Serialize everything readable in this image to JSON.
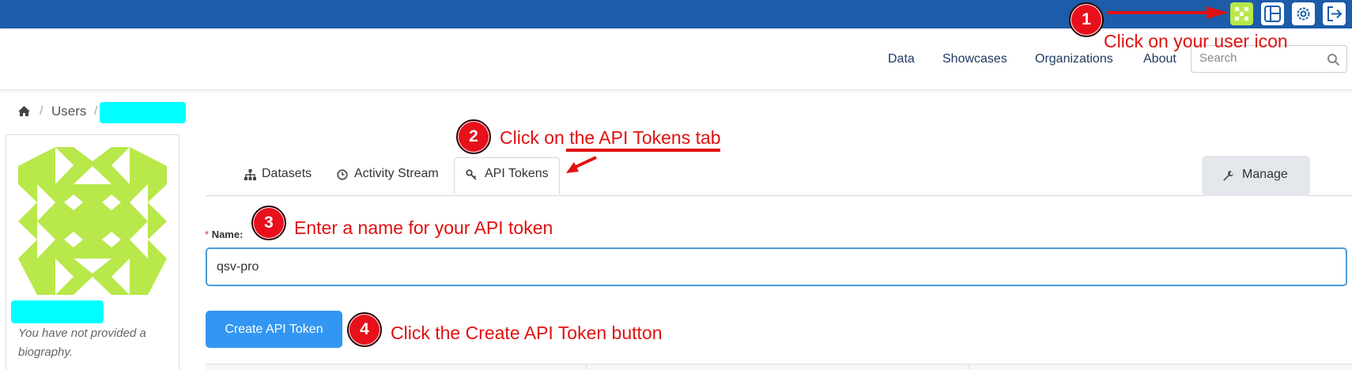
{
  "colors": {
    "topbar": "#1c5ca8",
    "accent": "#3296f3",
    "avatar": "#b8e84a",
    "annotation": "#e01010",
    "redaction": "#00ffff"
  },
  "topbar": {
    "icons": [
      "user-avatar-icon",
      "dashboard-icon",
      "gear-icon",
      "logout-icon"
    ]
  },
  "nav": {
    "links": [
      "Data",
      "Showcases",
      "Organizations",
      "About"
    ],
    "search_placeholder": "Search"
  },
  "breadcrumb": {
    "home_icon": "home-icon",
    "separator": "/",
    "users": "Users"
  },
  "profile": {
    "bio": "You have not provided a biography."
  },
  "tabs": {
    "datasets": "Datasets",
    "activity": "Activity Stream",
    "api_tokens": "API Tokens"
  },
  "actions": {
    "manage": "Manage",
    "create": "Create API Token"
  },
  "form": {
    "required_mark": "*",
    "name_label": "Name:",
    "name_value": "qsv-pro"
  },
  "annotations": [
    {
      "number": "1",
      "text": "Click on your user icon"
    },
    {
      "number": "2",
      "text": "Click on the API Tokens tab"
    },
    {
      "number": "3",
      "text": "Enter a name for your API token"
    },
    {
      "number": "4",
      "text": "Click the Create API Token button"
    }
  ]
}
